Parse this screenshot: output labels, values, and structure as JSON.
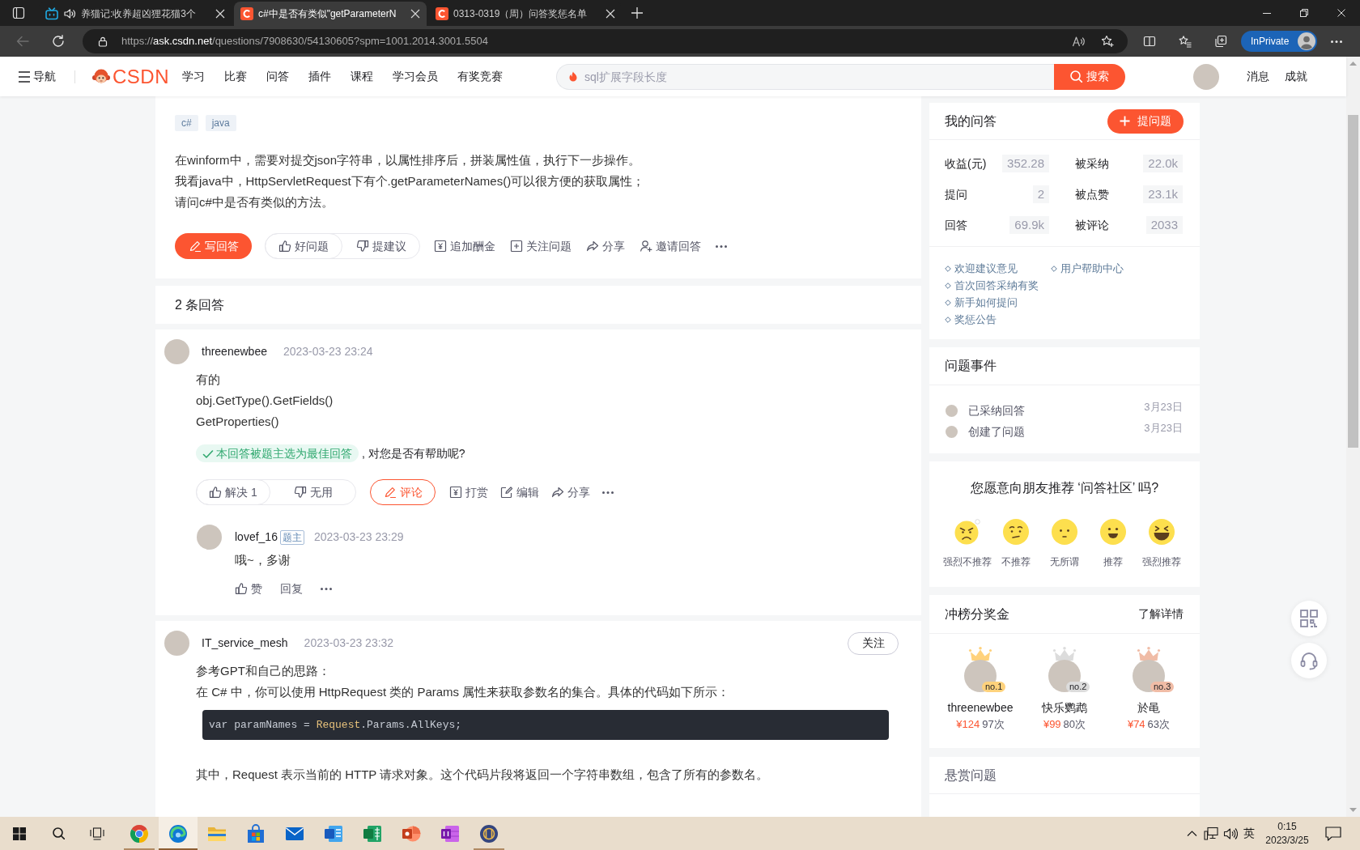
{
  "browser": {
    "tabs": [
      {
        "kind": "video",
        "title": "养猫记:收养超凶狸花猫3个",
        "playing": true,
        "selected": false
      },
      {
        "kind": "csdn",
        "title": "c#中是否有类似\"getParameterN",
        "playing": false,
        "selected": true
      },
      {
        "kind": "csdn",
        "title": "0313-0319（周）问答奖惩名单",
        "playing": false,
        "selected": false
      }
    ],
    "back_disabled": true,
    "address": {
      "scheme": "https://",
      "host": "ask.csdn.net",
      "path": "/questions/7908630/54130605?spm=1001.2014.3001.5504"
    },
    "profile_label": "InPrivate"
  },
  "site_nav": {
    "menu_label": "导航",
    "logo": "CSDN",
    "links": [
      "学习",
      "比赛",
      "问答",
      "插件",
      "课程",
      "学习会员",
      "有奖竞赛"
    ],
    "search": {
      "placeholder": "sql扩展字段长度",
      "button": "搜索"
    },
    "user_links": [
      "消息",
      "成就"
    ]
  },
  "question": {
    "tags": [
      "c#",
      "java"
    ],
    "body": [
      "在winform中，需要对提交json字符串，以属性排序后，拼装属性值，执行下一步操作。",
      "我看java中，HttpServletRequest下有个.getParameterNames()可以很方便的获取属性；",
      "请问c#中是否有类似的方法。"
    ],
    "answer_button": "写回答",
    "vote": [
      "好问题",
      "提建议"
    ],
    "actions": [
      {
        "kind": "bounty",
        "label": "追加酬金"
      },
      {
        "kind": "follow",
        "label": "关注问题"
      },
      {
        "kind": "share",
        "label": "分享"
      },
      {
        "kind": "invite",
        "label": "邀请回答"
      }
    ]
  },
  "answers_count": "2 条回答",
  "answers": [
    {
      "user": "threenewbee",
      "time": "2023-03-23 23:24",
      "blocks": [
        {
          "kind": "text",
          "text": "有的"
        },
        {
          "kind": "text",
          "text": "obj.GetType().GetFields()"
        },
        {
          "kind": "text",
          "text": "GetProperties()"
        }
      ],
      "accepted": true,
      "accepted_label": "本回答被题主选为最佳回答",
      "accepted_note": ", 对您是否有帮助呢?",
      "vote": [
        "解决 1",
        "无用"
      ],
      "comment_button": "评论",
      "actions": [
        {
          "kind": "reward",
          "label": "打赏"
        },
        {
          "kind": "edit",
          "label": "编辑"
        },
        {
          "kind": "share",
          "label": "分享"
        }
      ],
      "comments": [
        {
          "user": "lovef_16",
          "badge": "题主",
          "time": "2023-03-23 23:29",
          "text": "哦~，多谢",
          "actions": [
            {
              "kind": "like",
              "label": "赞"
            },
            {
              "kind": "reply",
              "label": "回复"
            }
          ]
        }
      ]
    },
    {
      "user": "IT_service_mesh",
      "time": "2023-03-23 23:32",
      "follow_button": "关注",
      "accepted": false,
      "blocks": [
        {
          "kind": "text",
          "text": "参考GPT和自己的思路："
        },
        {
          "kind": "text",
          "text": "在 C# 中，你可以使用 HttpRequest 类的 Params 属性来获取参数名的集合。具体的代码如下所示："
        },
        {
          "kind": "code",
          "tokens": [
            {
              "kind": "plain",
              "text": "var paramNames = "
            },
            {
              "kind": "type",
              "text": "Request"
            },
            {
              "kind": "plain",
              "text": ".Params.AllKeys;"
            }
          ]
        },
        {
          "kind": "text",
          "text": "其中，Request 表示当前的 HTTP 请求对象。这个代码片段将返回一个字符串数组，包含了所有的参数名。"
        }
      ]
    }
  ],
  "sidebar": {
    "my_qa": {
      "title": "我的问答",
      "ask_button": "提问题",
      "stats": [
        {
          "label": "收益(元)",
          "value": "352.28"
        },
        {
          "label": "被采纳",
          "value": "22.0k"
        },
        {
          "label": "提问",
          "value": "2"
        },
        {
          "label": "被点赞",
          "value": "23.1k"
        },
        {
          "label": "回答",
          "value": "69.9k"
        },
        {
          "label": "被评论",
          "value": "2033"
        }
      ],
      "link_rows": [
        [
          "欢迎建议意见",
          "用户帮助中心"
        ],
        [
          "首次回答采纳有奖"
        ],
        [
          "新手如何提问"
        ],
        [
          "奖惩公告"
        ]
      ]
    },
    "events": {
      "title": "问题事件",
      "items": [
        {
          "text": "已采纳回答",
          "date": "3月23日"
        },
        {
          "text": "创建了问题",
          "date": "3月23日"
        }
      ]
    },
    "recommend": {
      "title": "您愿意向朋友推荐 ‘问答社区’ 吗?",
      "options": [
        {
          "kind": "angry",
          "label": "强烈不推荐"
        },
        {
          "kind": "uneasy",
          "label": "不推荐"
        },
        {
          "kind": "neutral",
          "label": "无所谓"
        },
        {
          "kind": "smile",
          "label": "推荐"
        },
        {
          "kind": "laugh",
          "label": "强烈推荐"
        }
      ]
    },
    "leaderboard": {
      "title": "冲榜分奖金",
      "more": "了解详情",
      "entries": [
        {
          "rank": "no.1",
          "color": "#ffd27c",
          "name": "threenewbee",
          "amount": "¥124",
          "count": "97次"
        },
        {
          "rank": "no.2",
          "color": "#dcdcdc",
          "name": "快乐鹦鹉",
          "amount": "¥99",
          "count": "80次"
        },
        {
          "rank": "no.3",
          "color": "#f0bca6",
          "name": "於黾",
          "amount": "¥74",
          "count": "63次"
        }
      ]
    },
    "bounty": {
      "title": "悬赏问题"
    }
  },
  "taskbar": {
    "apps": [
      {
        "kind": "chrome",
        "running": true,
        "selected": false
      },
      {
        "kind": "edge",
        "running": true,
        "selected": true
      },
      {
        "kind": "files",
        "running": false,
        "selected": false
      },
      {
        "kind": "store",
        "running": false,
        "selected": false
      },
      {
        "kind": "mail",
        "running": false,
        "selected": false
      },
      {
        "kind": "word",
        "running": false,
        "selected": false
      },
      {
        "kind": "excel",
        "running": false,
        "selected": false
      },
      {
        "kind": "powerpoint",
        "running": false,
        "selected": false
      },
      {
        "kind": "onenote",
        "running": false,
        "selected": false
      },
      {
        "kind": "app",
        "running": true,
        "selected": false
      }
    ],
    "ime": "英",
    "time": "0:15",
    "date": "2023/3/25"
  }
}
